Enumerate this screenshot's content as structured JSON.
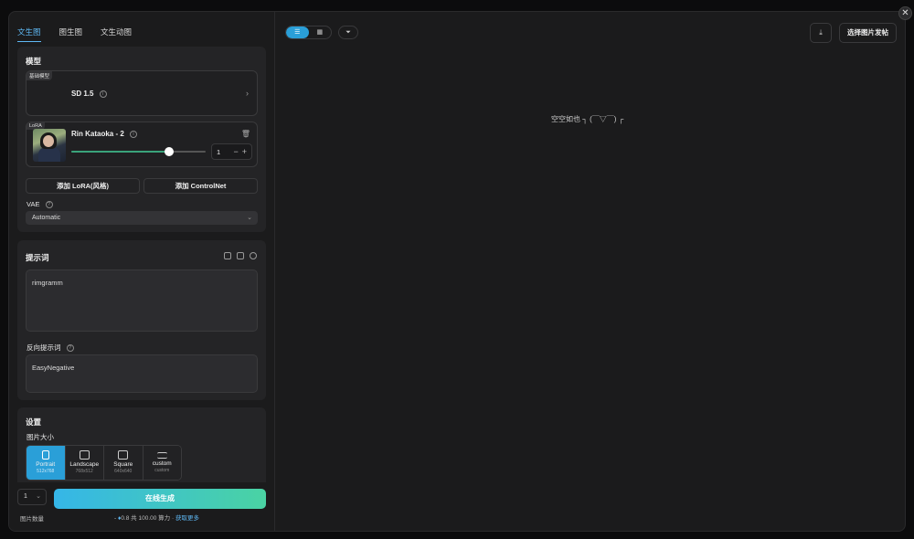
{
  "tabs": [
    "文生图",
    "图生图",
    "文生动图"
  ],
  "model": {
    "title": "模型",
    "tag": "基础模型",
    "name": "SD 1.5"
  },
  "lora": {
    "tag": "LoRA",
    "name": "Rin Kataoka - 2",
    "weight": 1,
    "slider_fraction": 0.73
  },
  "buttons": {
    "add_lora": "添加 LoRA(风格)",
    "add_controlnet": "添加 ControlNet"
  },
  "vae": {
    "label": "VAE",
    "value": "Automatic"
  },
  "prompt": {
    "title": "提示词",
    "value": "rimgramm",
    "negative_label": "反向提示词",
    "negative_value": "EasyNegative"
  },
  "settings": {
    "title": "设置",
    "size_label": "图片大小",
    "sizes": [
      {
        "name": "Portrait",
        "dims": "512x768"
      },
      {
        "name": "Landscape",
        "dims": "768x512"
      },
      {
        "name": "Square",
        "dims": "640x640"
      },
      {
        "name": "custom",
        "dims": "custom"
      }
    ]
  },
  "bottom": {
    "count_value": "1",
    "count_label": "图片数量",
    "generate": "在线生成",
    "cost_prefix": "- ",
    "cost_amount": "0.8",
    "cost_mid": " 共 100.00 算力 · ",
    "cost_link": "获取更多"
  },
  "right": {
    "pick_button": "选择图片发帖",
    "empty_text": "空空如也 ┐ (￣▽￣) ┌"
  },
  "colors": {
    "accent": "#2a9fd8",
    "slider": "#3aa37b"
  }
}
